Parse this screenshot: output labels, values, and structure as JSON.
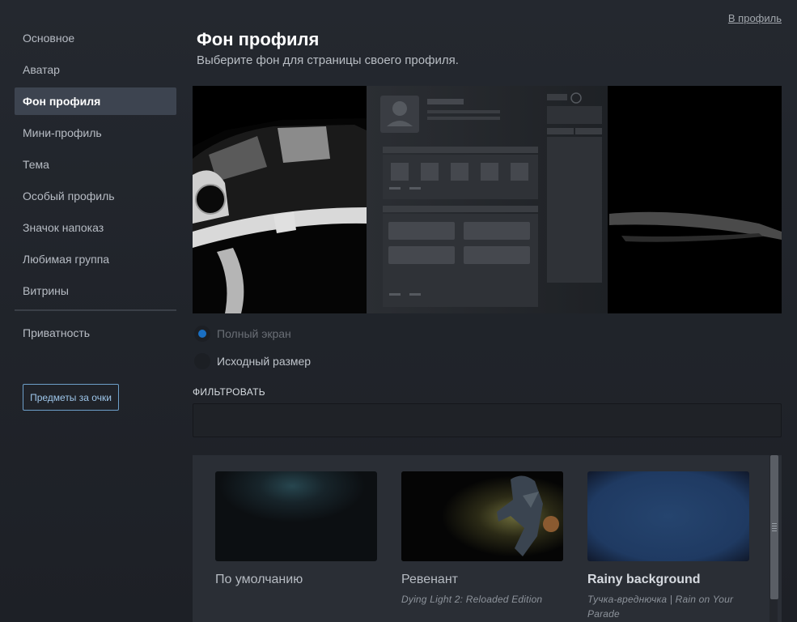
{
  "header": {
    "profile_link": "В профиль",
    "title": "Фон профиля",
    "subtitle": "Выберите фон для страницы своего профиля."
  },
  "sidebar": {
    "items": [
      {
        "label": "Основное",
        "active": false
      },
      {
        "label": "Аватар",
        "active": false
      },
      {
        "label": "Фон профиля",
        "active": true
      },
      {
        "label": "Мини-профиль",
        "active": false
      },
      {
        "label": "Тема",
        "active": false
      },
      {
        "label": "Особый профиль",
        "active": false
      },
      {
        "label": "Значок напоказ",
        "active": false
      },
      {
        "label": "Любимая группа",
        "active": false
      },
      {
        "label": "Витрины",
        "active": false
      }
    ],
    "privacy_label": "Приватность",
    "points_button": "Предметы за очки"
  },
  "display_mode": {
    "options": [
      {
        "label": "Полный экран",
        "selected": true
      },
      {
        "label": "Исходный размер",
        "selected": false
      }
    ]
  },
  "filter": {
    "label": "ФИЛЬТРОВАТЬ",
    "value": "",
    "placeholder": ""
  },
  "backgrounds": {
    "items": [
      {
        "name": "По умолчанию",
        "game": ""
      },
      {
        "name": "Ревенант",
        "game": "Dying Light 2: Reloaded Edition"
      },
      {
        "name": "Rainy background",
        "game": "Тучка-вреднючка | Rain on Your Parade"
      }
    ]
  },
  "colors": {
    "accent": "#1a6fc2",
    "active_nav": "#3d4450",
    "button_border": "#6d9fc9"
  }
}
